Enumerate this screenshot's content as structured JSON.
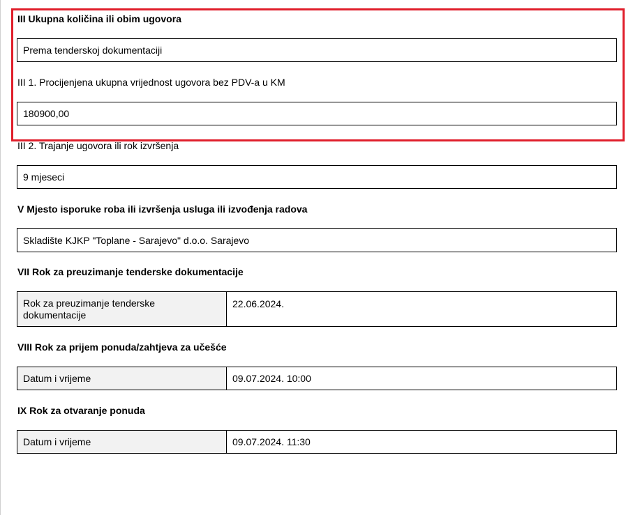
{
  "section_iii": {
    "heading": "III Ukupna količina ili obim ugovora",
    "quantity_value": "Prema tenderskoj dokumentaciji",
    "estimated_label": "III 1. Procijenjena ukupna vrijednost ugovora bez PDV-a u KM",
    "estimated_value": "180900,00",
    "duration_label": "III 2. Trajanje ugovora ili rok izvršenja",
    "duration_value": "9 mjeseci"
  },
  "section_v": {
    "heading": "V Mjesto isporuke roba ili izvršenja usluga ili izvođenja radova",
    "value": "Skladište KJKP \"Toplane - Sarajevo\" d.o.o. Sarajevo"
  },
  "section_vii": {
    "heading": "VII Rok za preuzimanje tenderske dokumentacije",
    "key": "Rok za preuzimanje tenderske dokumentacije",
    "value": "22.06.2024."
  },
  "section_viii": {
    "heading": "VIII Rok za prijem ponuda/zahtjeva za učešće",
    "key": "Datum i vrijeme",
    "value": "09.07.2024. 10:00"
  },
  "section_ix": {
    "heading": "IX Rok za otvaranje ponuda",
    "key": "Datum i vrijeme",
    "value": "09.07.2024. 11:30"
  },
  "colors": {
    "highlight": "#e01e2b",
    "key_cell_bg": "#f2f2f2"
  }
}
